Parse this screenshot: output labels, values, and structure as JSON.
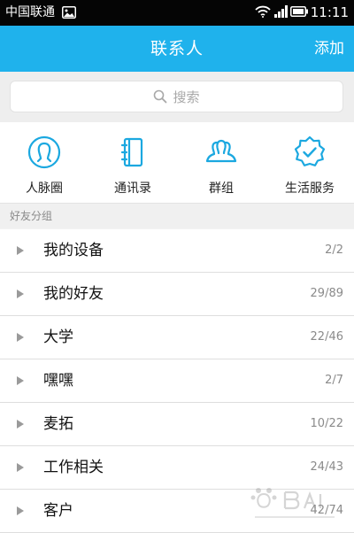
{
  "status_bar": {
    "carrier": "中国联通",
    "time": "11:11"
  },
  "header": {
    "title": "联系人",
    "add_label": "添加"
  },
  "search": {
    "placeholder": "搜索"
  },
  "quick_actions": [
    {
      "label": "人脉圈",
      "icon": "person-circle-icon"
    },
    {
      "label": "通讯录",
      "icon": "address-book-icon"
    },
    {
      "label": "群组",
      "icon": "group-icon"
    },
    {
      "label": "生活服务",
      "icon": "service-badge-icon"
    }
  ],
  "section_title": "好友分组",
  "groups": [
    {
      "name": "我的设备",
      "count": "2/2"
    },
    {
      "name": "我的好友",
      "count": "29/89"
    },
    {
      "name": "大学",
      "count": "22/46"
    },
    {
      "name": "嘿嘿",
      "count": "2/7"
    },
    {
      "name": "麦拓",
      "count": "10/22"
    },
    {
      "name": "工作相关",
      "count": "24/43"
    },
    {
      "name": "客户",
      "count": "42/74"
    }
  ],
  "colors": {
    "accent": "#1fb2ec",
    "status_bar": "#050505",
    "icon_blue": "#1ba8e0"
  }
}
